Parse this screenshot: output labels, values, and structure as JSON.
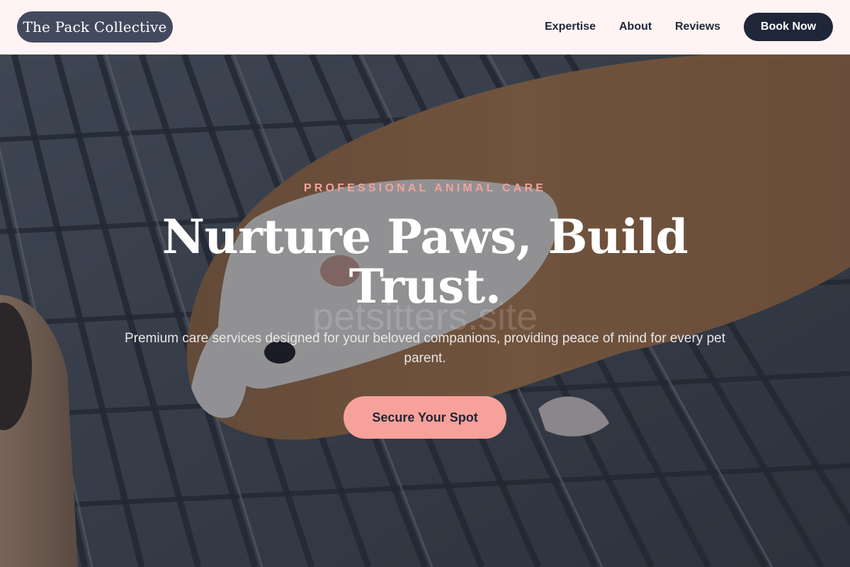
{
  "header": {
    "brand": "The Pack Collective",
    "nav": {
      "expertise": "Expertise",
      "about": "About",
      "reviews": "Reviews"
    },
    "cta_label": "Book Now"
  },
  "hero": {
    "eyebrow": "PROFESSIONAL ANIMAL CARE",
    "headline": "Nurture Paws, Build Trust.",
    "watermark": "petsitters.site",
    "subtext": "Premium care services designed for your beloved companions, providing peace of mind for every pet parent.",
    "cta_label": "Secure Your Spot",
    "image_subject": "guinea pig on a metal grate"
  },
  "colors": {
    "background": "#fff4f3",
    "navy": "#1e2638",
    "logo_pill": "#434a5e",
    "accent_pink": "#f7a19b",
    "eyebrow_pink": "#f3a29c"
  }
}
